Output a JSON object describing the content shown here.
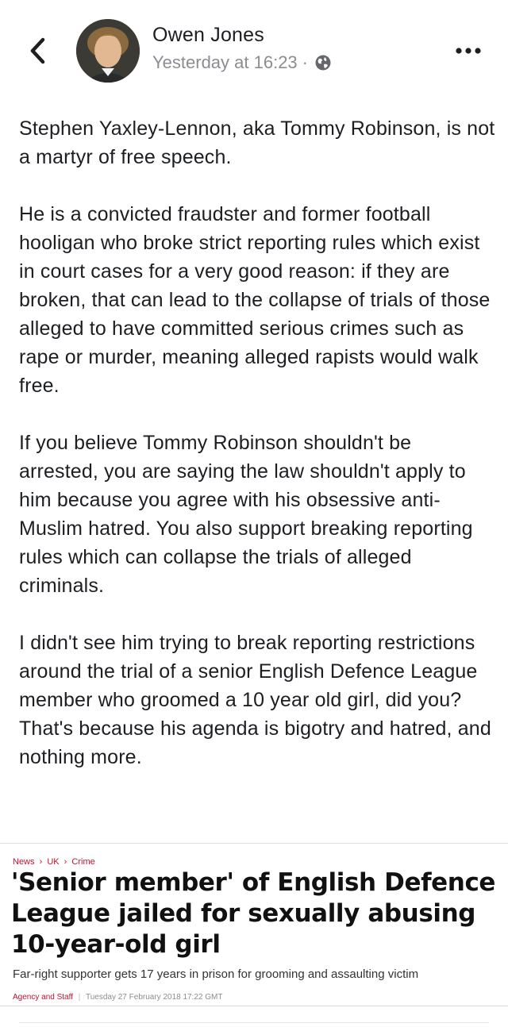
{
  "header": {
    "author_name": "Owen Jones",
    "timestamp": "Yesterday at 16:23",
    "meta_separator": "·",
    "privacy_icon": "globe-icon",
    "back_icon": "chevron-left-icon",
    "more_icon": "more-horizontal-icon"
  },
  "post": {
    "paragraphs": [
      "Stephen Yaxley-Lennon, aka Tommy Robinson, is not a martyr of free speech.",
      "He is a convicted fraudster and former football hooligan who broke strict reporting rules which exist in court cases for a very good reason: if they are broken, that can lead to the collapse of trials of those alleged to have committed serious crimes such as rape or murder, meaning alleged rapists would walk free.",
      "If you believe Tommy Robinson shouldn't be arrested, you are saying the law shouldn't apply to him because you agree with his obsessive anti-Muslim hatred. You also support breaking reporting rules which can collapse the trials of alleged criminals.",
      "I didn't see him trying to break reporting restrictions around the trial of a senior English Defence League member who groomed a 10 year old girl, did you? That's because his agenda is bigotry and hatred, and nothing more."
    ]
  },
  "article": {
    "breadcrumb": [
      "News",
      "UK",
      "Crime"
    ],
    "breadcrumb_separator": "›",
    "headline": "'Senior member' of English Defence League jailed for sexually abusing 10-year-old girl",
    "subheading": "Far-right supporter gets 17 years in prison for grooming and assaulting victim",
    "byline_author": "Agency and Staff",
    "byline_divider": "|",
    "byline_date": "Tuesday 27 February 2018 17:22 GMT"
  },
  "colors": {
    "text": "#1c1e21",
    "meta": "#8a8d91",
    "accent_red": "#c8102e"
  }
}
